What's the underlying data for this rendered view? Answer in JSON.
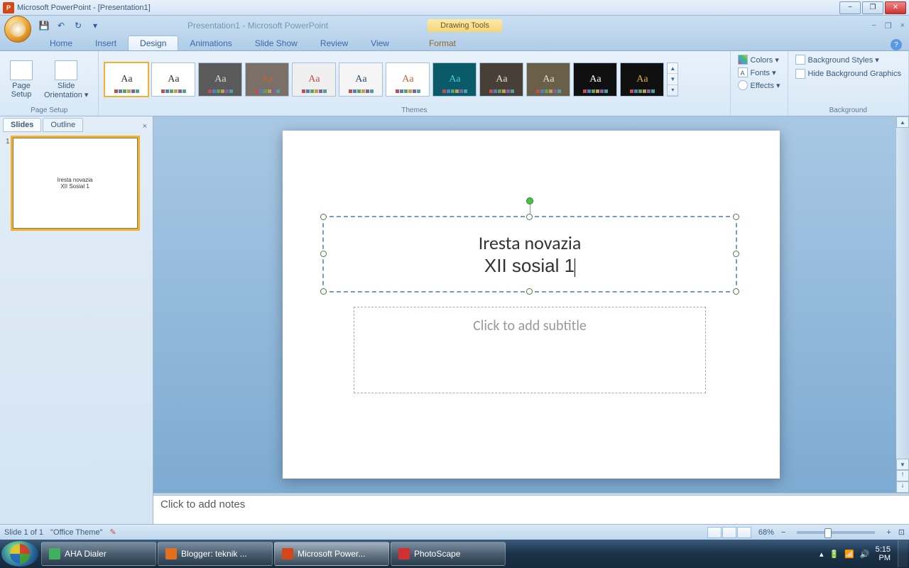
{
  "window": {
    "title": "Microsoft PowerPoint - [Presentation1]",
    "document_title": "Presentation1 - Microsoft PowerPoint",
    "context_tab": "Drawing Tools",
    "minimize": "−",
    "restore": "❐",
    "close": "✕"
  },
  "qat": {
    "save": "💾",
    "undo": "↶",
    "redo": "↻",
    "custom": "▾"
  },
  "tabs": {
    "home": "Home",
    "insert": "Insert",
    "design": "Design",
    "animations": "Animations",
    "slideshow": "Slide Show",
    "review": "Review",
    "view": "View",
    "format": "Format"
  },
  "ribbon": {
    "page_setup": {
      "page_setup": "Page\nSetup",
      "orientation": "Slide\nOrientation ▾",
      "label": "Page Setup"
    },
    "themes": {
      "label": "Themes",
      "items": [
        {
          "aa": "Aa",
          "bg": "#ffffff",
          "fg": "#333"
        },
        {
          "aa": "Aa",
          "bg": "#ffffff",
          "fg": "#333"
        },
        {
          "aa": "Aa",
          "bg": "#5a5a5a",
          "fg": "#ddd"
        },
        {
          "aa": "Aa",
          "bg": "#7a7068",
          "fg": "#c9602e"
        },
        {
          "aa": "Aa",
          "bg": "#efefef",
          "fg": "#c05050"
        },
        {
          "aa": "Aa",
          "bg": "#f5f5f5",
          "fg": "#2a4a6a"
        },
        {
          "aa": "Aa",
          "bg": "#ffffff",
          "fg": "#c06030"
        },
        {
          "aa": "Aa",
          "bg": "#0a5a6a",
          "fg": "#4ad0d0"
        },
        {
          "aa": "Aa",
          "bg": "#484038",
          "fg": "#e8e0d0"
        },
        {
          "aa": "Aa",
          "bg": "#6a604a",
          "fg": "#e8e0c8"
        },
        {
          "aa": "Aa",
          "bg": "#101010",
          "fg": "#ffffff"
        },
        {
          "aa": "Aa",
          "bg": "#101010",
          "fg": "#d8b050"
        }
      ]
    },
    "theme_opts": {
      "colors": "Colors ▾",
      "fonts": "Fonts ▾",
      "effects": "Effects ▾"
    },
    "background": {
      "styles": "Background Styles ▾",
      "hide": "Hide Background Graphics",
      "label": "Background"
    }
  },
  "slide_panel": {
    "tab_slides": "Slides",
    "tab_outline": "Outline",
    "thumb_line1": "Iresta novazia",
    "thumb_line2": "XII Sosial 1",
    "num": "1"
  },
  "slide": {
    "title_line1": "Iresta novazia",
    "title_line2": "XII sosial 1",
    "subtitle_placeholder": "Click to add subtitle"
  },
  "notes": {
    "placeholder": "Click to add notes"
  },
  "status": {
    "slide": "Slide 1 of 1",
    "theme": "\"Office Theme\"",
    "zoom": "68%",
    "fit": "⊡"
  },
  "taskbar": {
    "items": [
      {
        "label": "AHA Dialer",
        "color": "#40b060"
      },
      {
        "label": "Blogger: teknik ...",
        "color": "#e07020"
      },
      {
        "label": "Microsoft Power...",
        "color": "#d44817"
      },
      {
        "label": "PhotoScape",
        "color": "#d03030"
      }
    ],
    "time": "5:15\nPM"
  }
}
